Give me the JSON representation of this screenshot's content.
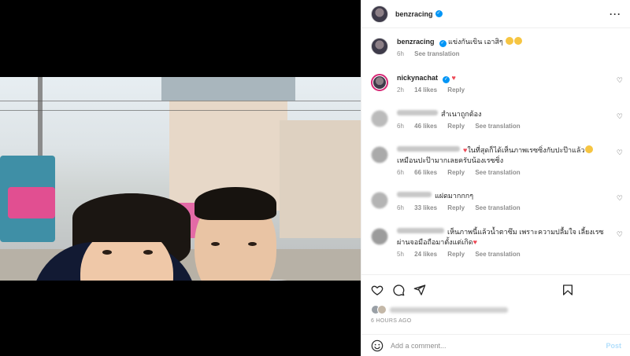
{
  "post": {
    "author": "benzracing",
    "verified_icon": "verified-badge-icon",
    "more_icon": "more-horizontal-icon"
  },
  "caption": {
    "username": "benzracing",
    "text": "แข่งกันเขิน เอาสิๆ",
    "time": "6h",
    "translation": "See translation"
  },
  "comments": [
    {
      "username": "nickynachat",
      "text": "",
      "time": "2h",
      "likes": "14 likes",
      "reply": "Reply",
      "translation": "",
      "username_blurred": false
    },
    {
      "username": "",
      "text": "สำเนาถูกต้อง",
      "time": "6h",
      "likes": "46 likes",
      "reply": "Reply",
      "translation": "See translation",
      "username_blurred": true
    },
    {
      "username": "",
      "text": "ในที่สุดก็ได้เห็นภาพเรซซิ่งกับปะป๊าแล้ว",
      "text2": "เหมือนปะป๊ามากเลยครับน้องเรซซิ่ง",
      "time": "6h",
      "likes": "66 likes",
      "reply": "Reply",
      "translation": "See translation",
      "username_blurred": true
    },
    {
      "username": "",
      "text": "แฝดมากกกๆ",
      "time": "6h",
      "likes": "33 likes",
      "reply": "Reply",
      "translation": "See translation",
      "username_blurred": true
    },
    {
      "username": "",
      "text": "เห็นภาพนี้แล้วน้ำตาซึม เพราะความปลื้มใจ เลี้ยงเรซ",
      "text2": "ผ่านจอมือถือมาตั้งแต่เกิด",
      "time": "5h",
      "likes": "24 likes",
      "reply": "Reply",
      "translation": "See translation",
      "username_blurred": true
    }
  ],
  "actions": {
    "like_icon": "heart-icon",
    "comment_icon": "comment-icon",
    "share_icon": "send-icon",
    "save_icon": "bookmark-icon"
  },
  "timestamp": "6 HOURS AGO",
  "add_comment": {
    "placeholder": "Add a comment...",
    "post_label": "Post",
    "emoji_icon": "smile-icon"
  },
  "colors": {
    "accent": "#0095f6",
    "heart": "#ed4956",
    "muted": "#8e8e8e",
    "post_disabled": "#b2dffc"
  }
}
